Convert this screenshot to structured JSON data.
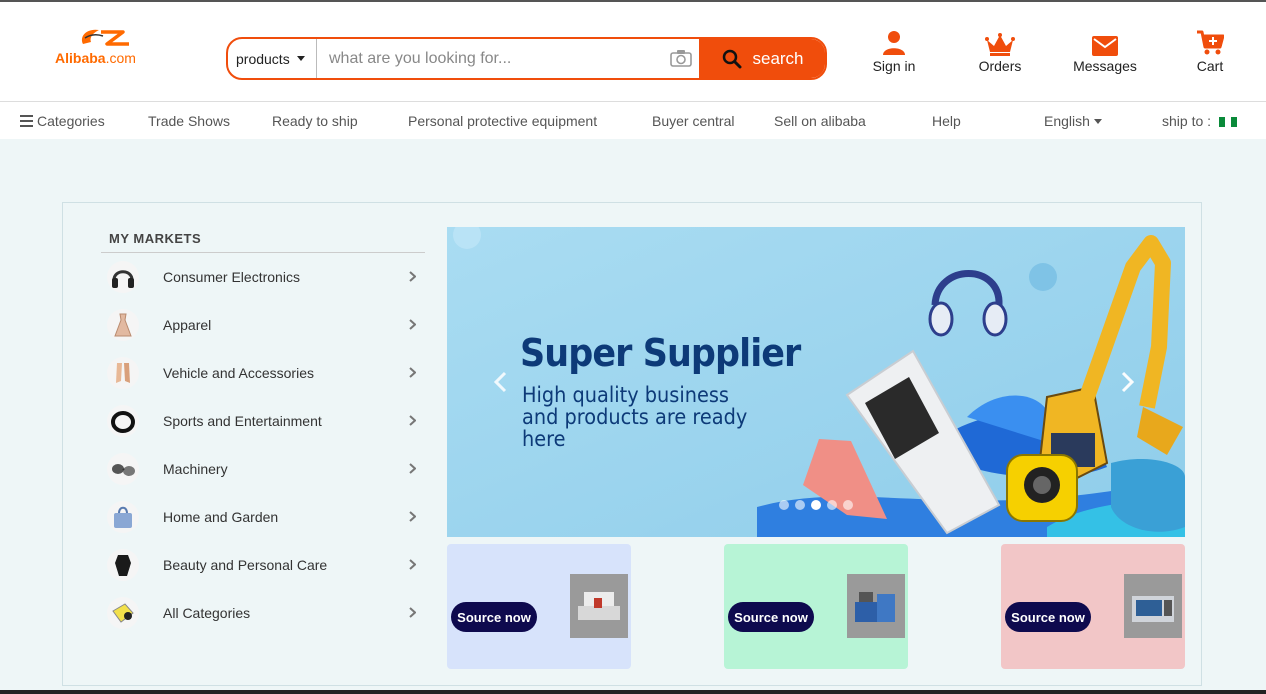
{
  "header": {
    "logo_text": "Alibaba",
    "logo_suffix": ".com",
    "search": {
      "category": "products",
      "placeholder": "what are you looking for...",
      "button_label": "search"
    },
    "actions": [
      {
        "label": "Sign in",
        "icon": "user-icon"
      },
      {
        "label": "Orders",
        "icon": "crown-icon"
      },
      {
        "label": "Messages",
        "icon": "mail-icon"
      },
      {
        "label": "Cart",
        "icon": "cart-icon"
      }
    ],
    "accent_color": "#f04d0c"
  },
  "nav": {
    "categories": "Categories",
    "items": [
      "Trade Shows",
      "Ready to ship",
      "Personal protective equipment",
      "Buyer central",
      "Sell on alibaba",
      "Help"
    ],
    "language": "English",
    "ship_to": "ship to :"
  },
  "markets": {
    "title": "MY MARKETS",
    "items": [
      {
        "label": "Consumer Electronics",
        "icon": "headphones-icon"
      },
      {
        "label": "Apparel",
        "icon": "dress-icon"
      },
      {
        "label": "Vehicle and Accessories",
        "icon": "shoes-icon"
      },
      {
        "label": "Sports and Entertainment",
        "icon": "ring-icon"
      },
      {
        "label": "Machinery",
        "icon": "sunglasses-icon"
      },
      {
        "label": "Home and Garden",
        "icon": "bag-icon"
      },
      {
        "label": "Beauty and Personal Care",
        "icon": "bottle-icon"
      },
      {
        "label": "All Categories",
        "icon": "grid-icon"
      }
    ]
  },
  "banner": {
    "title": "Super Supplier",
    "subtitle": "High quality business and products are ready here",
    "slide_count": 5,
    "active_slide": 3
  },
  "promos": [
    {
      "button": "Source now",
      "bg": "#d7e3fb"
    },
    {
      "button": "Source now",
      "bg": "#b7f4d6"
    },
    {
      "button": "Source now",
      "bg": "#f2c6c7"
    }
  ]
}
